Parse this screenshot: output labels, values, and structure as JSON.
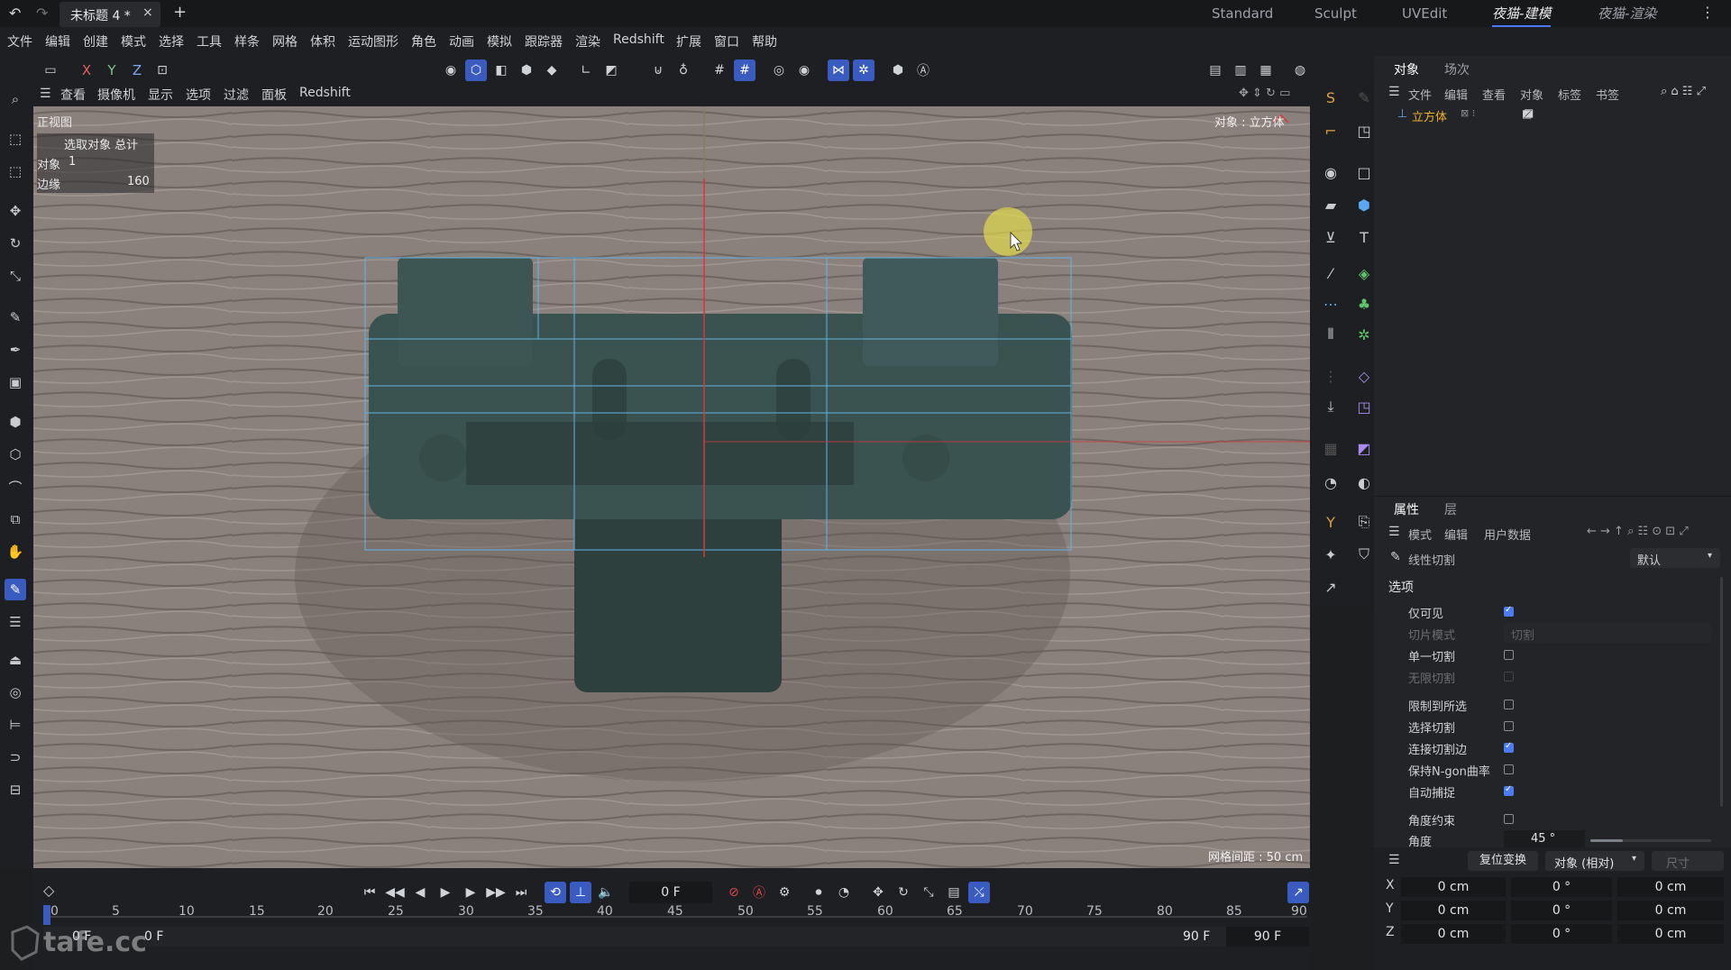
{
  "titlebar": {
    "undo_icon": "undo-icon",
    "redo_icon": "redo-icon",
    "doc_tab": "未标题 4 *",
    "close_glyph": "×",
    "add_glyph": "+",
    "layouts": [
      "Standard",
      "Sculpt",
      "UVEdit",
      "夜猫-建模",
      "夜猫-渲染"
    ],
    "more_glyph": "⋮"
  },
  "menubar": [
    "文件",
    "编辑",
    "创建",
    "模式",
    "选择",
    "工具",
    "样条",
    "网格",
    "体积",
    "运动图形",
    "角色",
    "动画",
    "模拟",
    "跟踪器",
    "渲染",
    "Redshift",
    "扩展",
    "窗口",
    "帮助"
  ],
  "toolbar": {
    "axes": [
      "X",
      "Y",
      "Z"
    ]
  },
  "viewport_menu": [
    "查看",
    "摄像机",
    "显示",
    "选项",
    "过滤",
    "面板",
    "Redshift"
  ],
  "viewport": {
    "view_name": "正视图",
    "hud_header": "选取对象 总计",
    "hud_rows": [
      {
        "label": "对象",
        "value": "1"
      },
      {
        "label": "边缘",
        "value": "160"
      }
    ],
    "object_label": "对象 : 立方体",
    "grid_spacing": "网格间距 : 50 cm"
  },
  "object_manager": {
    "tabs": [
      "对象",
      "场次"
    ],
    "menu": [
      "文件",
      "编辑",
      "查看",
      "对象",
      "标签",
      "书签"
    ],
    "object_name": "立方体"
  },
  "attributes": {
    "tabs": [
      "属性",
      "层"
    ],
    "menu": [
      "模式",
      "编辑",
      "用户数据"
    ],
    "tool_name": "线性切割",
    "preset": "默认",
    "section": "选项",
    "options": [
      {
        "label": "仅可见",
        "type": "checkbox",
        "checked": true,
        "enabled": true
      },
      {
        "label": "切片模式",
        "type": "select",
        "value": "切割",
        "enabled": false
      },
      {
        "label": "单一切割",
        "type": "checkbox",
        "checked": false,
        "enabled": true
      },
      {
        "label": "无限切割",
        "type": "checkbox",
        "checked": false,
        "enabled": false
      },
      {
        "label": "限制到所选",
        "type": "checkbox",
        "checked": false,
        "enabled": true
      },
      {
        "label": "选择切割",
        "type": "checkbox",
        "checked": false,
        "enabled": true
      },
      {
        "label": "连接切割边",
        "type": "checkbox",
        "checked": true,
        "enabled": true
      },
      {
        "label": "保持N-gon曲率",
        "type": "checkbox",
        "checked": false,
        "enabled": true
      },
      {
        "label": "自动捕捉",
        "type": "checkbox",
        "checked": true,
        "enabled": true
      },
      {
        "label": "角度约束",
        "type": "checkbox",
        "checked": false,
        "enabled": true
      },
      {
        "label": "角度",
        "type": "slider",
        "value": "45 °",
        "enabled": true
      }
    ]
  },
  "coordinates": {
    "reset_button": "复位变换",
    "mode_select": "对象 (相对)",
    "size_label": "尺寸",
    "rows": [
      {
        "axis": "X",
        "pos": "0 cm",
        "rot": "0 °",
        "size": "0 cm"
      },
      {
        "axis": "Y",
        "pos": "0 cm",
        "rot": "0 °",
        "size": "0 cm"
      },
      {
        "axis": "Z",
        "pos": "0 cm",
        "rot": "0 °",
        "size": "0 cm"
      }
    ]
  },
  "timeline": {
    "current_frame": "0 F",
    "ticks": [
      "0",
      "5",
      "10",
      "15",
      "20",
      "25",
      "30",
      "35",
      "40",
      "45",
      "50",
      "55",
      "60",
      "65",
      "70",
      "75",
      "80",
      "85",
      "90"
    ],
    "range_start": "0 F",
    "range_start2": "0 F",
    "range_end": "90 F",
    "range_end2": "90 F"
  },
  "watermark": "tafe.cc",
  "colors": {
    "accent": "#3a5bbf",
    "checkbox_on": "#4c7cf5",
    "axis_red": "#d23a3a",
    "axis_green": "#5fa36b",
    "mesh_lines": "#5fb3e6"
  }
}
